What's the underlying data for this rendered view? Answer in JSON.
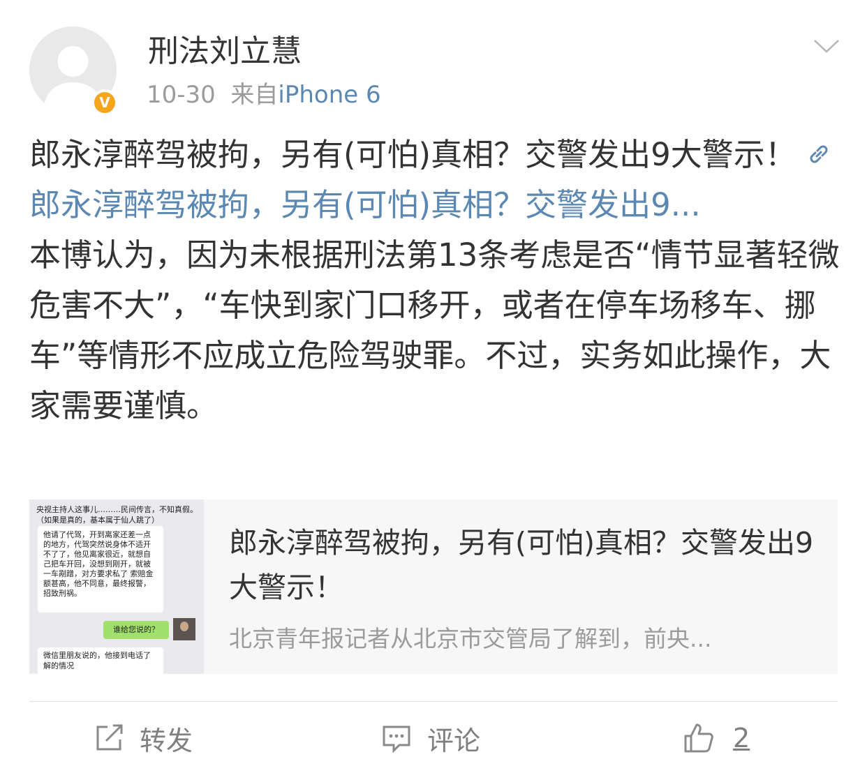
{
  "header": {
    "username": "刑法刘立慧",
    "date": "10-30",
    "source_prefix": "来自",
    "device": "iPhone 6",
    "verified_badge": "V"
  },
  "post": {
    "title_text": "郎永淳醉驾被拘，另有(可怕)真相？交警发出9大警示！",
    "link_text": "郎永淳醉驾被拘，另有(可怕)真相？交警发出9...",
    "body_text": "本博认为，因为未根据刑法第13条考虑是否“情节显著轻微危害不大”，“车快到家门口移开，或者在停车场移车、挪车”等情形不应成立危险驾驶罪。不过，实务如此操作，大家需要谨慎。"
  },
  "card": {
    "title": "郎永淳醉驾被拘，另有(可怕)真相？交警发出9大警示！",
    "description": "北京青年报记者从北京市交管局了解到，前央...",
    "thumbnail": {
      "line1": "央视主持人这事儿………民间传言，不知真假。",
      "line2": "（如果是真的，基本属于仙人跳了）",
      "bubble1": "他请了代驾，开到离家还差一点的地方，代驾突然说身体不适开不了了，他见离家很近，就想自己把车开回，没想到刚开，就被一车剐蹭，对方要求私了 索赔金额甚高，他不同意，最终报警，招致刑祸。",
      "bubble2": "谁给您说的？",
      "bubble3": "微信里朋友说的，他接到电话了解的情况"
    }
  },
  "actions": {
    "repost_label": "转发",
    "comment_label": "评论",
    "like_count": "2"
  },
  "colors": {
    "link": "#5b88b3",
    "verified": "#f4a51c",
    "muted": "#9b9b9b"
  },
  "icons": [
    "chevron-down-icon",
    "link-icon",
    "repost-icon",
    "comment-icon",
    "like-icon",
    "verified-icon",
    "default-avatar-icon"
  ]
}
